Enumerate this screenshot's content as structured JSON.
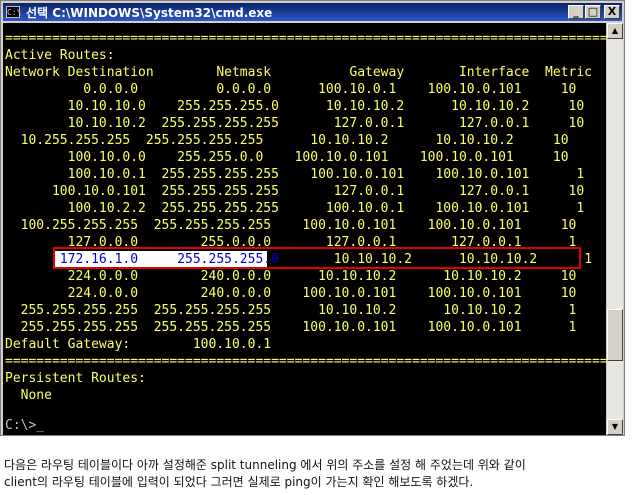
{
  "window": {
    "title": "선택 C:\\WINDOWS\\System32\\cmd.exe",
    "icon_label": "C:\\",
    "minimize": "_",
    "maximize": "□",
    "close": "X"
  },
  "console": {
    "lines": [
      "===============================================================================",
      "Active Routes:",
      "Network Destination        Netmask          Gateway       Interface  Metric",
      "          0.0.0.0          0.0.0.0      100.10.0.1    100.10.0.101     10",
      "        10.10.10.0    255.255.255.0      10.10.10.2      10.10.10.2     10",
      "        10.10.10.2  255.255.255.255       127.0.0.1       127.0.0.1     10",
      "  10.255.255.255  255.255.255.255      10.10.10.2      10.10.10.2     10",
      "        100.10.0.0    255.255.0.0    100.10.0.101    100.10.0.101     10",
      "        100.10.0.1  255.255.255.255    100.10.0.101    100.10.0.101      1",
      "      100.10.0.101  255.255.255.255       127.0.0.1       127.0.0.1     10",
      "        100.10.2.2  255.255.255.255      100.10.0.1    100.10.0.101      1",
      "  100.255.255.255  255.255.255.255    100.10.0.101    100.10.0.101     10",
      "        127.0.0.0        255.0.0.0       127.0.0.1       127.0.0.1      1",
      "",
      "        224.0.0.0        240.0.0.0      10.10.10.2      10.10.10.2     10",
      "        224.0.0.0        240.0.0.0    100.10.0.101    100.10.0.101     10",
      "  255.255.255.255  255.255.255.255      10.10.10.2      10.10.10.2      1",
      "  255.255.255.255  255.255.255.255    100.10.0.101    100.10.0.101      1",
      "Default Gateway:        100.10.0.1",
      "===============================================================================",
      "Persistent Routes:",
      "  None",
      ""
    ],
    "highlighted_row": {
      "selected": "172.16.1.0     255.255.255.0",
      "rest": "       10.10.10.2      10.10.10.2      1",
      "lead": "       "
    },
    "prompt": "C:\\>_"
  },
  "caption": {
    "line1": "다음은 라우팅 테이블이다 아까 설정해준 split tunneling 에서 위의 주소를 설정 해 주었는데 위와 같이",
    "line2": "client의 라우팅 테이블에 입력이 되었다 그러면 실제로 ping이 가는지 확인 해보도록 하겠다."
  }
}
